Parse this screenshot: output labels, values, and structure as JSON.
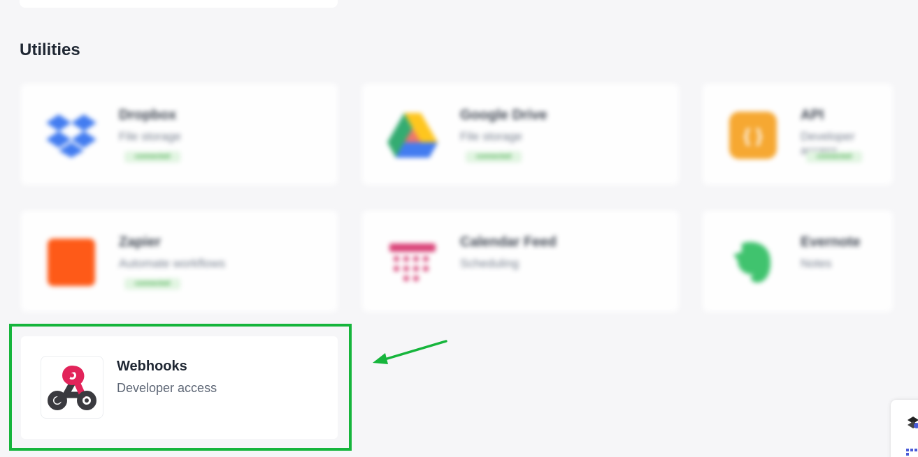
{
  "section": {
    "title": "Utilities"
  },
  "integrations": [
    {
      "name": "Dropbox",
      "category": "File storage",
      "badge": "connected",
      "icon": "dropbox-icon",
      "color": "#2f6ff0"
    },
    {
      "name": "Google Drive",
      "category": "File storage",
      "badge": "connected",
      "icon": "google-drive-icon",
      "color": "#1fa463"
    },
    {
      "name": "API",
      "category": "Developer access",
      "badge": "connected",
      "icon": "api-icon",
      "color": "#f7a01d"
    },
    {
      "name": "Zapier",
      "category": "Automate workflows",
      "badge": "connected",
      "icon": "zapier-icon",
      "color": "#ff4a00"
    },
    {
      "name": "Calendar Feed",
      "category": "Scheduling",
      "icon": "calendar-icon",
      "color": "#d7306a"
    },
    {
      "name": "Evernote",
      "category": "Notes",
      "icon": "evernote-icon",
      "color": "#2dbe60"
    }
  ],
  "webhooks": {
    "name": "Webhooks",
    "category": "Developer access",
    "icon": "webhooks-icon"
  },
  "accents": {
    "highlight": "#16b53c",
    "arrow": "#16b53c"
  }
}
